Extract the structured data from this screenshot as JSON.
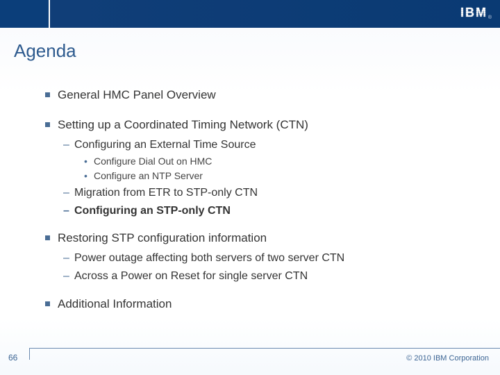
{
  "header": {
    "logo_text": "IBM",
    "registered": "®"
  },
  "title": "Agenda",
  "agenda": {
    "item1": "General HMC Panel Overview",
    "item2": "Setting up a Coordinated Timing Network (CTN)",
    "item2a": "Configuring an External Time Source",
    "item2a1": "Configure Dial Out on HMC",
    "item2a2": "Configure an NTP Server",
    "item2b": "Migration from ETR to STP-only CTN",
    "item2c": "Configuring an STP-only CTN",
    "item3": "Restoring STP configuration information",
    "item3a": "Power outage affecting both servers of two server CTN",
    "item3b": "Across a Power on Reset for single server CTN",
    "item4": "Additional Information"
  },
  "footer": {
    "page": "66",
    "copyright": "© 2010 IBM Corporation"
  }
}
